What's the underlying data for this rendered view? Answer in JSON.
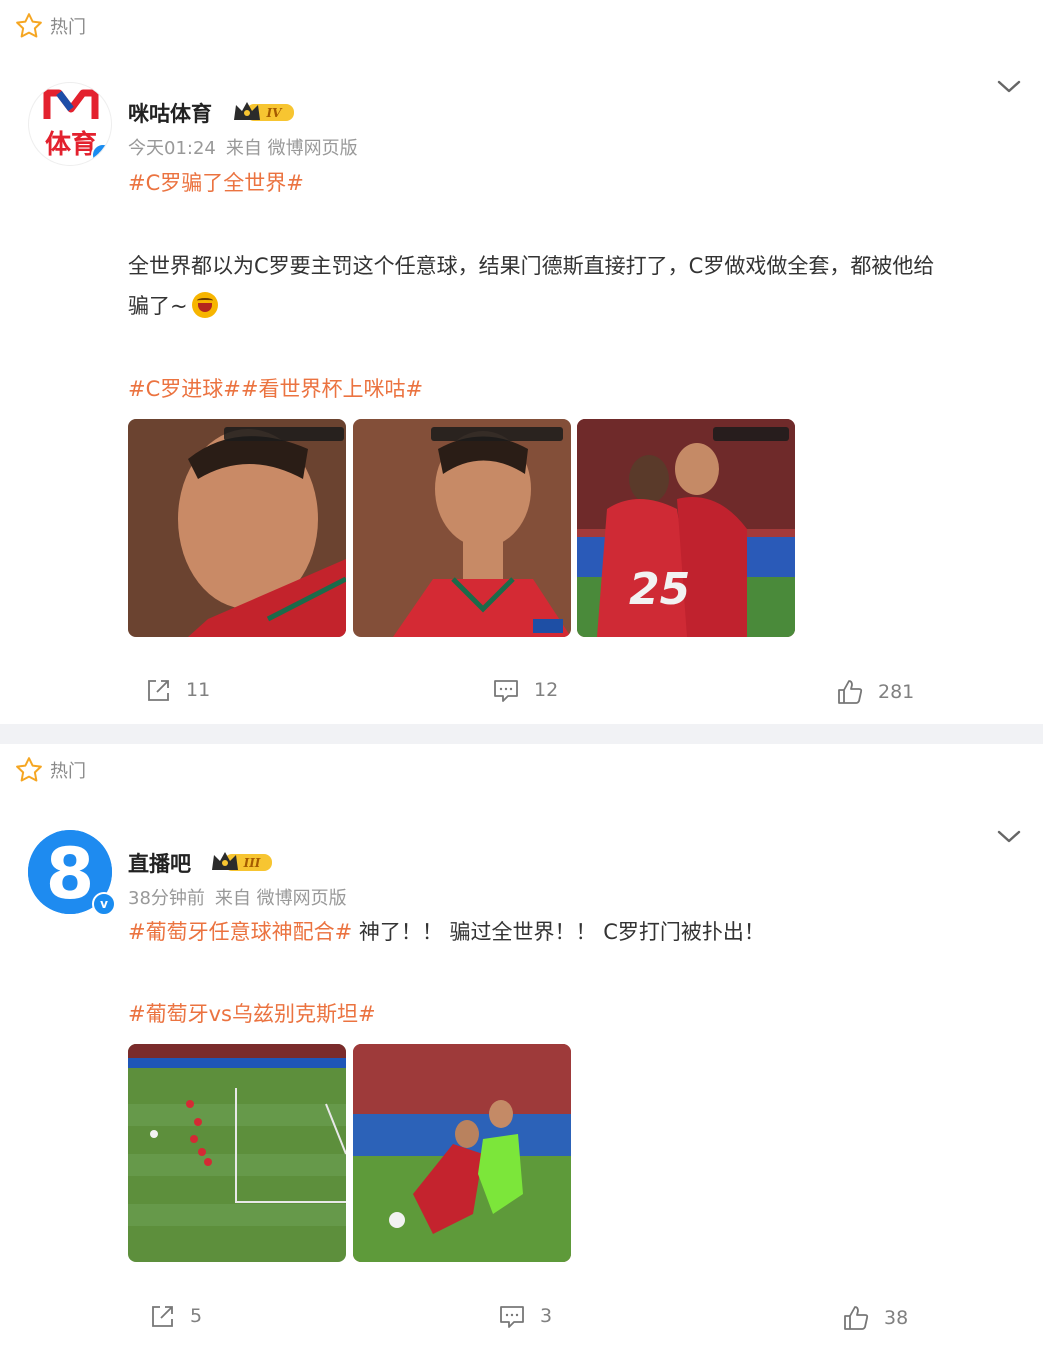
{
  "hot_label": "热门",
  "posts": [
    {
      "author": "咪咕体育",
      "time": "今天01:24",
      "source": "来自 微博网页版",
      "topic_head": "#C罗骗了全世界#",
      "body_line1": "全世界都以为C罗要主罚这个任意球，结果门德斯直接打了，C罗做戏做全套，都被他给",
      "body_line2": "骗了~",
      "topic_foot": "#C罗进球##看世界杯上咪咕#",
      "repost": "11",
      "comments": "12",
      "likes": "281",
      "avatar_text": "体育",
      "level": "IV"
    },
    {
      "author": "直播吧",
      "time": "38分钟前",
      "source": "来自 微博网页版",
      "topic_head": "#葡萄牙任意球神配合#",
      "body": " 神了！！ 骗过全世界！！ C罗打门被扑出！",
      "topic_foot": "#葡萄牙vs乌兹别克斯坦#",
      "repost": "5",
      "comments": "3",
      "likes": "38",
      "avatar_text": "8",
      "level": "III"
    }
  ],
  "verified_mark": "v",
  "colors": {
    "topic": "#eb7340",
    "muted": "#999999",
    "verified": "#1a8cf0",
    "divider": "#f1f2f5"
  }
}
